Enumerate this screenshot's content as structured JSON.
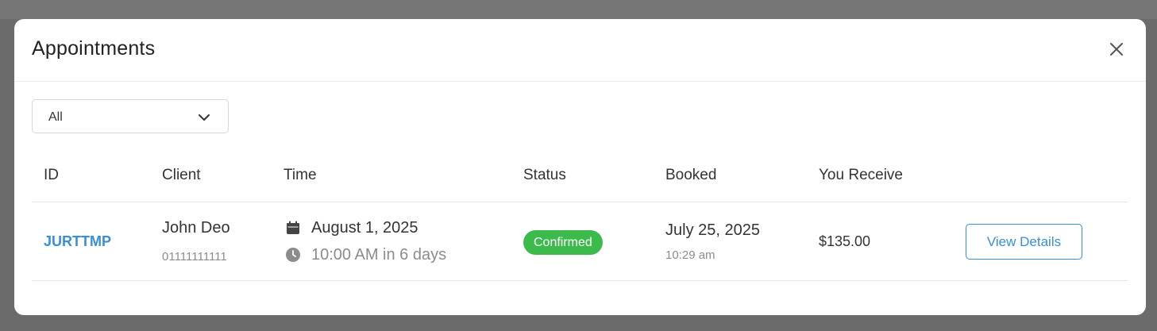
{
  "modal": {
    "title": "Appointments"
  },
  "filter": {
    "selected": "All"
  },
  "table": {
    "headers": {
      "id": "ID",
      "client": "Client",
      "time": "Time",
      "status": "Status",
      "booked": "Booked",
      "receive": "You Receive"
    },
    "rows": [
      {
        "id": "JURTTMP",
        "client_name": "John Deo",
        "client_phone": "01111111111",
        "date": "August 1, 2025",
        "time_relative": "10:00 AM in 6 days",
        "status": "Confirmed",
        "booked_date": "July 25, 2025",
        "booked_time": "10:29 am",
        "receive": "$135.00",
        "action_label": "View Details"
      }
    ]
  },
  "colors": {
    "accent": "#3a8fd0",
    "status_confirmed": "#3cba4c",
    "overlay": "#6b6b6b"
  },
  "icons": {
    "close": "close-icon",
    "dropdown": "chevron-down-icon",
    "date": "calendar-icon",
    "time": "clock-icon"
  }
}
